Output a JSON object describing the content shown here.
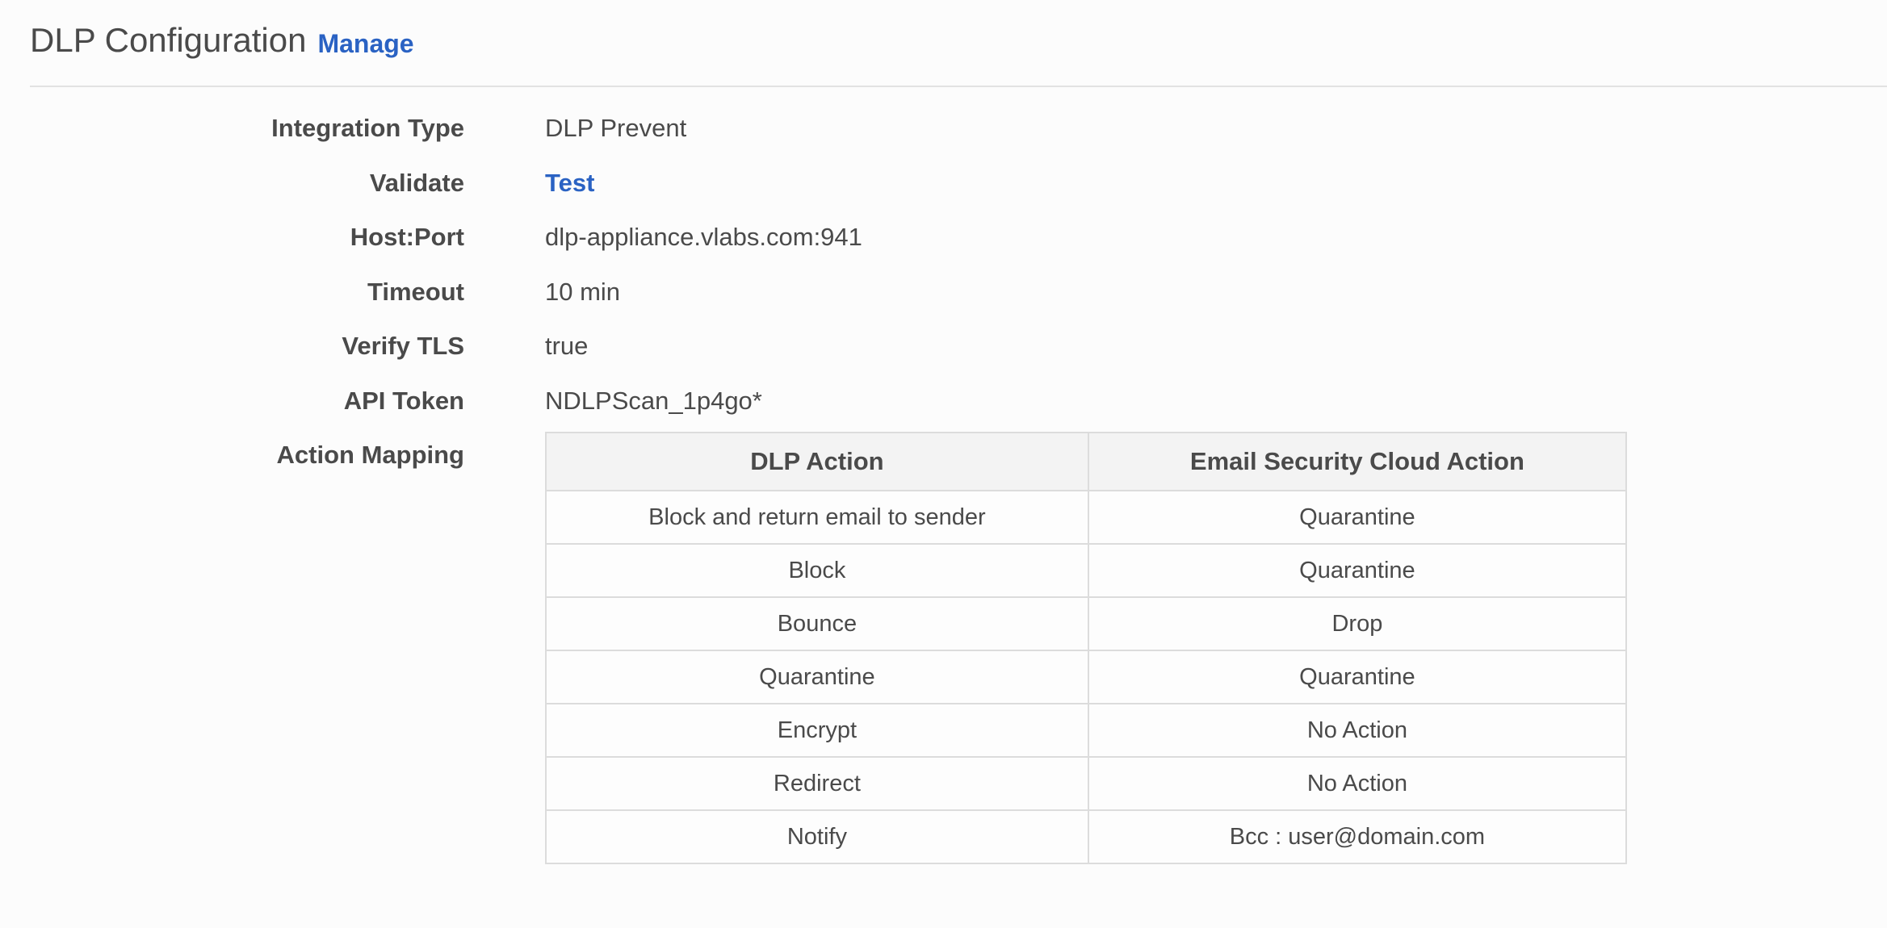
{
  "header": {
    "title": "DLP Configuration",
    "manage_label": "Manage"
  },
  "fields": [
    {
      "label": "Integration Type",
      "value": "DLP Prevent"
    },
    {
      "label": "Validate",
      "value": "Test"
    },
    {
      "label": "Host:Port",
      "value": "dlp-appliance.vlabs.com:941"
    },
    {
      "label": "Timeout",
      "value": "10 min"
    },
    {
      "label": "Verify TLS",
      "value": "true"
    },
    {
      "label": "API Token",
      "value": "NDLPScan_1p4go*"
    }
  ],
  "action_mapping": {
    "label": "Action Mapping",
    "columns": [
      "DLP Action",
      "Email Security Cloud Action"
    ],
    "rows": [
      [
        "Block and return email to sender",
        "Quarantine"
      ],
      [
        "Block",
        "Quarantine"
      ],
      [
        "Bounce",
        "Drop"
      ],
      [
        "Quarantine",
        "Quarantine"
      ],
      [
        "Encrypt",
        "No Action"
      ],
      [
        "Redirect",
        "No Action"
      ],
      [
        "Notify",
        "Bcc : user@domain.com"
      ]
    ]
  },
  "colors": {
    "link": "#2a62c3",
    "text": "#4a4a4a",
    "border": "#dcdcdc",
    "header_bg": "#f3f3f3"
  }
}
